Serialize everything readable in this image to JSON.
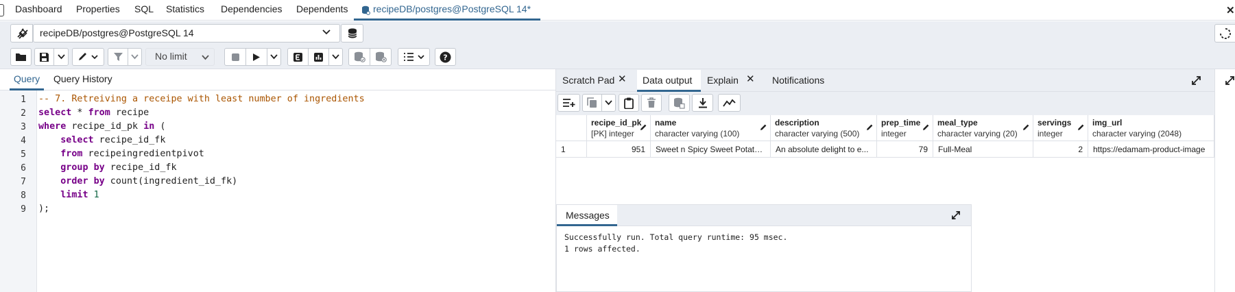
{
  "top_tabs": [
    "Dashboard",
    "Properties",
    "SQL",
    "Statistics",
    "Dependencies",
    "Dependents",
    "recipeDB/postgres@PostgreSQL 14*"
  ],
  "connection": {
    "label": "recipeDB/postgres@PostgreSQL 14"
  },
  "toolbar": {
    "limit_value": "No limit"
  },
  "query_tabs": [
    "Query",
    "Query History"
  ],
  "editor": {
    "line_numbers": [
      "1",
      "2",
      "3",
      "4",
      "5",
      "6",
      "7",
      "8",
      "9"
    ],
    "lines": [
      "-- 7. Retreiving a receipe with least number of ingredients",
      "select * from recipe",
      "where recipe_id_pk in (",
      "    select recipe_id_fk",
      "    from recipeingredientpivot",
      "    group by recipe_id_fk",
      "    order by count(ingredient_id_fk)",
      "    limit 1",
      ");"
    ]
  },
  "output_tabs": [
    "Scratch Pad",
    "Data output",
    "Explain",
    "Notifications"
  ],
  "grid": {
    "columns": [
      {
        "name": "recipe_id_pk",
        "type": "[PK] integer"
      },
      {
        "name": "name",
        "type": "character varying (100)"
      },
      {
        "name": "description",
        "type": "character varying (500)"
      },
      {
        "name": "prep_time",
        "type": "integer"
      },
      {
        "name": "meal_type",
        "type": "character varying (20)"
      },
      {
        "name": "servings",
        "type": "integer"
      },
      {
        "name": "img_url",
        "type": "character varying (2048)"
      }
    ],
    "rows": [
      {
        "num": "1",
        "cells": [
          "951",
          "Sweet n Spicy Sweet Potato...",
          "An absolute delight to e...",
          "79",
          "Full-Meal",
          "2",
          "https://edamam-product-image"
        ]
      }
    ]
  },
  "messages": {
    "title": "Messages",
    "lines": [
      "Successfully run. Total query runtime: 95 msec.",
      "1 rows affected."
    ]
  }
}
